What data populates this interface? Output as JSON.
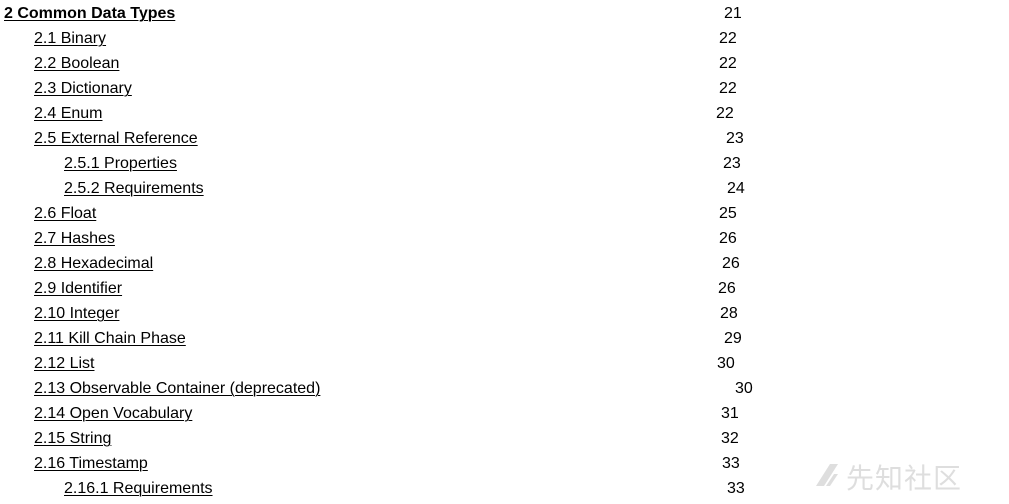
{
  "toc": {
    "items": [
      {
        "label": "2 Common Data Types",
        "page": "21"
      },
      {
        "label": "2.1 Binary",
        "page": "22"
      },
      {
        "label": "2.2 Boolean",
        "page": "22"
      },
      {
        "label": "2.3 Dictionary",
        "page": "22"
      },
      {
        "label": "2.4 Enum",
        "page": "22"
      },
      {
        "label": "2.5 External Reference",
        "page": "23"
      },
      {
        "label": "2.5.1 Properties",
        "page": "23"
      },
      {
        "label": "2.5.2 Requirements",
        "page": "24"
      },
      {
        "label": "2.6 Float",
        "page": "25"
      },
      {
        "label": "2.7 Hashes",
        "page": "26"
      },
      {
        "label": "2.8 Hexadecimal",
        "page": "26"
      },
      {
        "label": "2.9 Identifier",
        "page": "26"
      },
      {
        "label": "2.10 Integer",
        "page": "28"
      },
      {
        "label": "2.11 Kill Chain Phase",
        "page": "29"
      },
      {
        "label": "2.12 List",
        "page": "30"
      },
      {
        "label": "2.13 Observable Container (deprecated)",
        "page": "30"
      },
      {
        "label": "2.14 Open Vocabulary",
        "page": "31"
      },
      {
        "label": "2.15 String",
        "page": "32"
      },
      {
        "label": "2.16 Timestamp",
        "page": "33"
      },
      {
        "label": "2.16.1 Requirements",
        "page": "33"
      }
    ]
  },
  "watermark": {
    "text": "先知社区",
    "icon": "xianzhi-logo-icon"
  }
}
